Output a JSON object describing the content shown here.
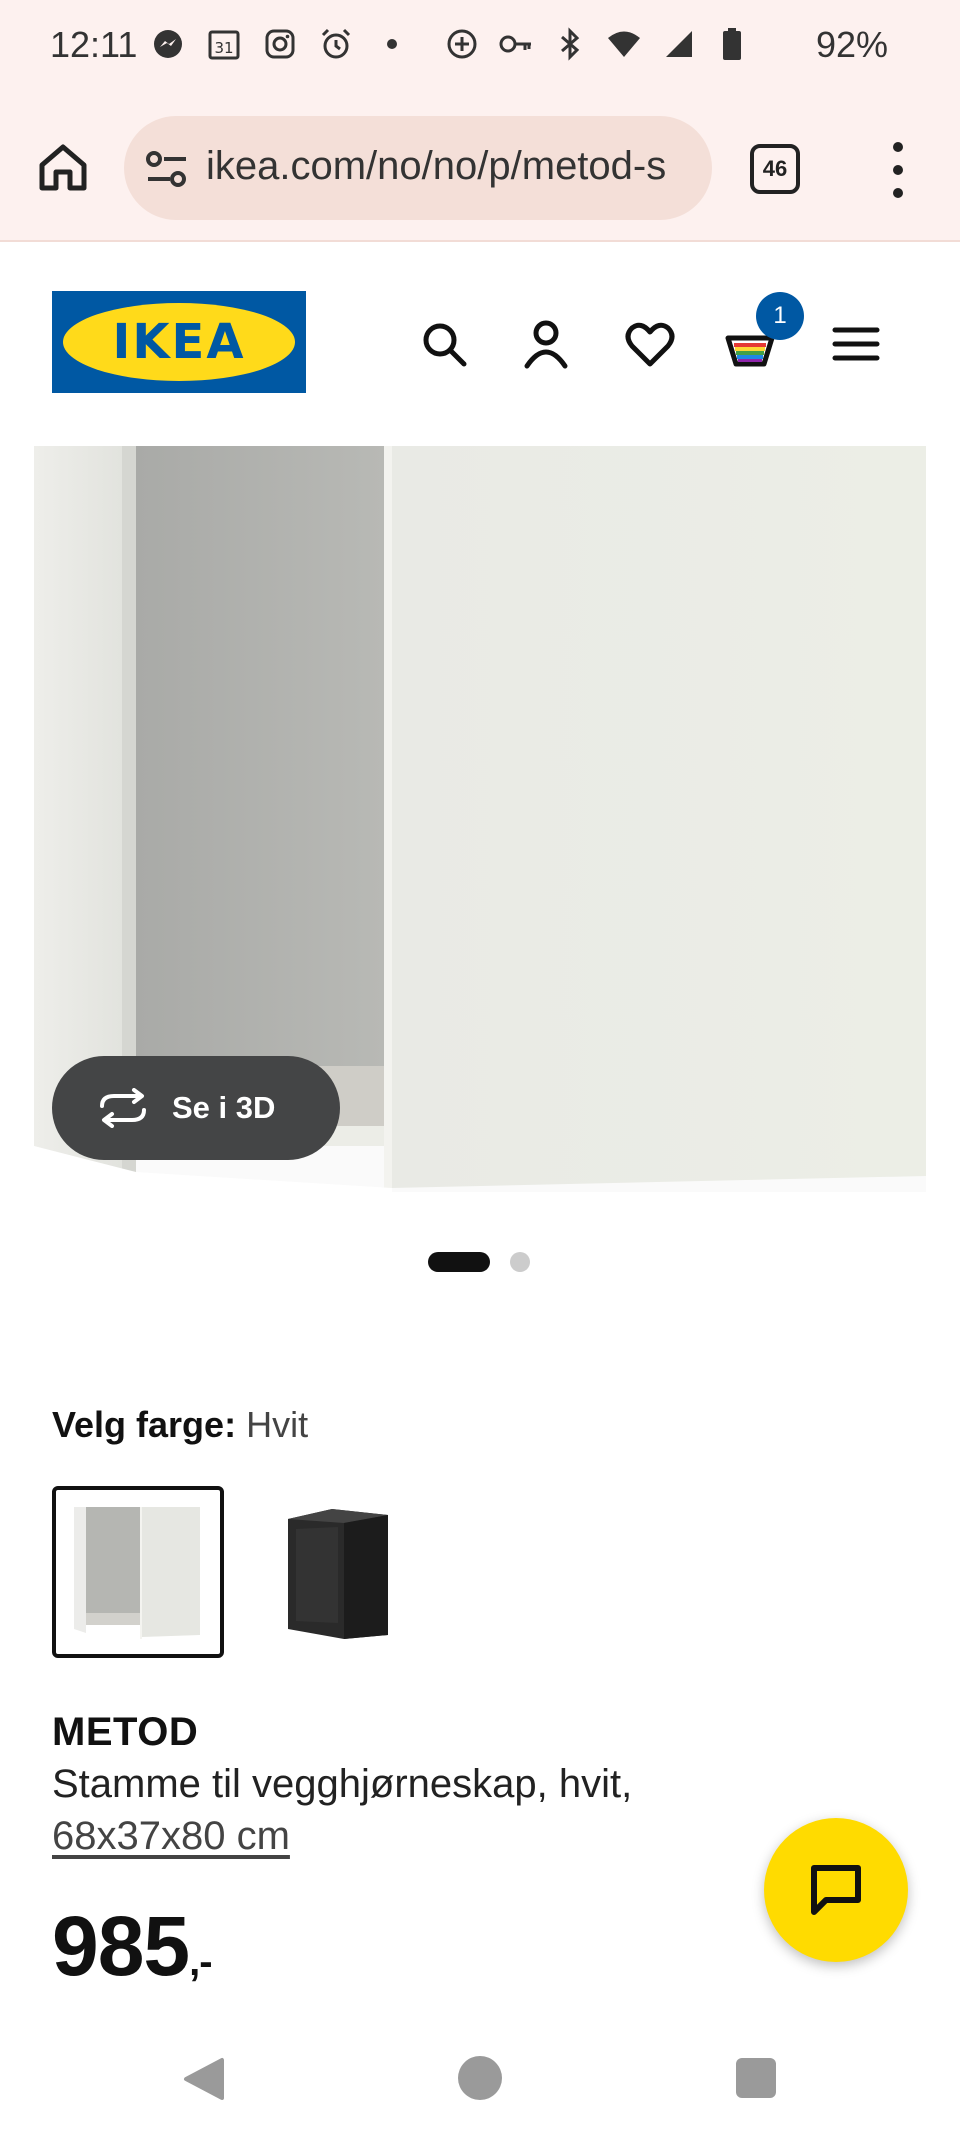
{
  "status_bar": {
    "time": "12:11",
    "battery": "92%",
    "calendar_day": "31"
  },
  "browser": {
    "url": "ikea.com/no/no/p/metod-s",
    "tab_count": "46"
  },
  "header": {
    "logo_text": "IKEA",
    "cart_count": "1",
    "icons": [
      "search-icon",
      "account-icon",
      "heart-icon",
      "cart-icon",
      "hamburger-menu-icon"
    ]
  },
  "gallery": {
    "view_3d_label": "Se i 3D",
    "slide_count": 2,
    "active_slide": 1
  },
  "color_picker": {
    "label": "Velg farge:",
    "selected_value": "Hvit",
    "swatches": [
      "white-cabinet",
      "black-cabinet"
    ]
  },
  "product": {
    "name": "METOD",
    "description": "Stamme til vegghjørneskap, hvit,",
    "size": "68x37x80 cm",
    "price": "985",
    "price_suffix": ",-"
  },
  "colors": {
    "ikea_blue": "#0058a3",
    "ikea_yellow": "#ffda1a",
    "chat_yellow": "#ffdb00",
    "browser_bg": "#fdf1ef"
  }
}
